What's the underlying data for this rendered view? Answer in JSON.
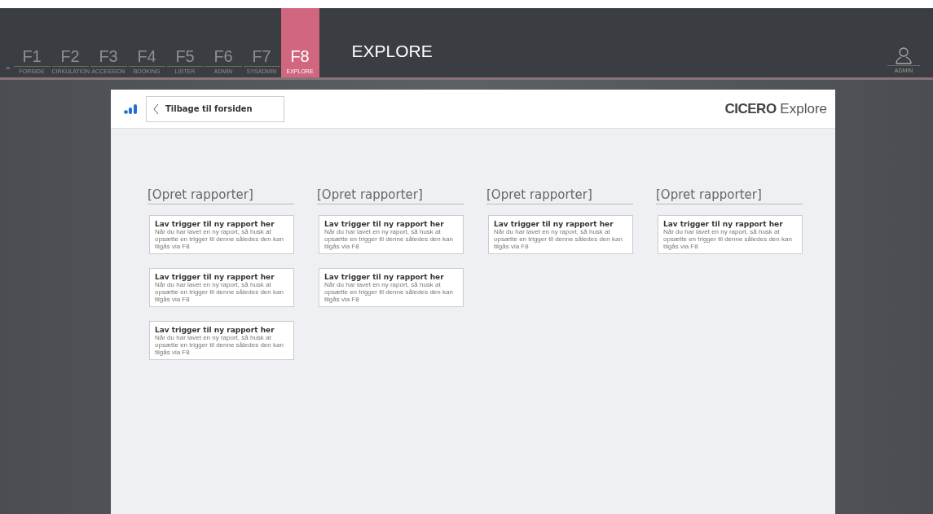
{
  "topbar": {
    "tabs": [
      {
        "key": "F1",
        "label": "FORSIDE",
        "selected": false
      },
      {
        "key": "F2",
        "label": "CIRKULATION",
        "selected": false
      },
      {
        "key": "F3",
        "label": "ACCESSION",
        "selected": false
      },
      {
        "key": "F4",
        "label": "BOOKING",
        "selected": false
      },
      {
        "key": "F5",
        "label": "LISTER",
        "selected": false
      },
      {
        "key": "F6",
        "label": "ADMIN",
        "selected": false
      },
      {
        "key": "F7",
        "label": "SYSADMIN",
        "selected": false
      },
      {
        "key": "F8",
        "label": "EXPLORE",
        "selected": true
      }
    ],
    "collapse": "^",
    "title": "EXPLORE",
    "user": "ADMIN"
  },
  "header": {
    "back_button": "Tilbage til forsiden",
    "logo_bold": "CICERO",
    "logo_light": "Explore"
  },
  "columns": [
    {
      "heading": "[Opret rapporter]",
      "cards": [
        {
          "title": "Lav trigger til ny rapport her",
          "text": "Når du har lavet en ny raport, så husk at opsætte en trigger til denne således den kan tilgås via F8"
        },
        {
          "title": "Lav trigger til ny rapport her",
          "text": "Når du har lavet en ny raport, så husk at opsætte en trigger til denne således den kan tilgås via F8"
        },
        {
          "title": "Lav trigger til ny rapport her",
          "text": "Når du har lavet en ny raport, så husk at opsætte en trigger til denne således den kan tilgås via F8"
        }
      ]
    },
    {
      "heading": "[Opret rapporter]",
      "cards": [
        {
          "title": "Lav trigger til ny rapport her",
          "text": "Når du har lavet en ny raport, så husk at opsætte en trigger til denne således den kan tilgås via F8"
        },
        {
          "title": "Lav trigger til ny rapport her",
          "text": "Når du har lavet en ny raport, så husk at opsætte en trigger til denne således den kan tilgås via F8"
        }
      ]
    },
    {
      "heading": "[Opret rapporter]",
      "cards": [
        {
          "title": "Lav trigger til ny rapport her",
          "text": "Når du har lavet en ny raport, så husk at opsætte en trigger til denne således den kan tilgås via F8"
        }
      ]
    },
    {
      "heading": "[Opret rapporter]",
      "cards": [
        {
          "title": "Lav trigger til ny rapport her",
          "text": "Når du har lavet en ny raport, så husk at opsætte en trigger til denne således den kan tilgås via F8"
        }
      ]
    }
  ]
}
